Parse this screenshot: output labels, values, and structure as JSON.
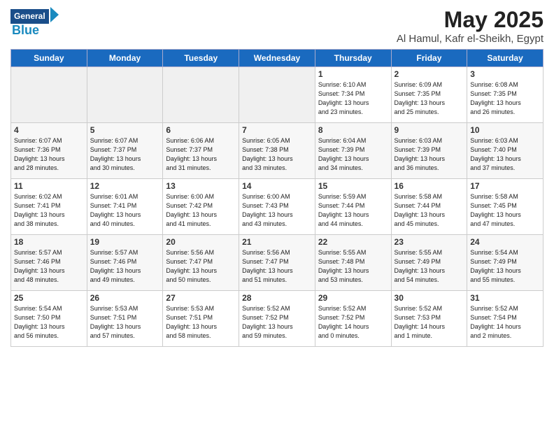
{
  "header": {
    "logo_line1": "General",
    "logo_line2": "Blue",
    "title": "May 2025",
    "subtitle": "Al Hamul, Kafr el-Sheikh, Egypt"
  },
  "days_of_week": [
    "Sunday",
    "Monday",
    "Tuesday",
    "Wednesday",
    "Thursday",
    "Friday",
    "Saturday"
  ],
  "weeks": [
    [
      {
        "day": "",
        "detail": ""
      },
      {
        "day": "",
        "detail": ""
      },
      {
        "day": "",
        "detail": ""
      },
      {
        "day": "",
        "detail": ""
      },
      {
        "day": "1",
        "detail": "Sunrise: 6:10 AM\nSunset: 7:34 PM\nDaylight: 13 hours\nand 23 minutes."
      },
      {
        "day": "2",
        "detail": "Sunrise: 6:09 AM\nSunset: 7:35 PM\nDaylight: 13 hours\nand 25 minutes."
      },
      {
        "day": "3",
        "detail": "Sunrise: 6:08 AM\nSunset: 7:35 PM\nDaylight: 13 hours\nand 26 minutes."
      }
    ],
    [
      {
        "day": "4",
        "detail": "Sunrise: 6:07 AM\nSunset: 7:36 PM\nDaylight: 13 hours\nand 28 minutes."
      },
      {
        "day": "5",
        "detail": "Sunrise: 6:07 AM\nSunset: 7:37 PM\nDaylight: 13 hours\nand 30 minutes."
      },
      {
        "day": "6",
        "detail": "Sunrise: 6:06 AM\nSunset: 7:37 PM\nDaylight: 13 hours\nand 31 minutes."
      },
      {
        "day": "7",
        "detail": "Sunrise: 6:05 AM\nSunset: 7:38 PM\nDaylight: 13 hours\nand 33 minutes."
      },
      {
        "day": "8",
        "detail": "Sunrise: 6:04 AM\nSunset: 7:39 PM\nDaylight: 13 hours\nand 34 minutes."
      },
      {
        "day": "9",
        "detail": "Sunrise: 6:03 AM\nSunset: 7:39 PM\nDaylight: 13 hours\nand 36 minutes."
      },
      {
        "day": "10",
        "detail": "Sunrise: 6:03 AM\nSunset: 7:40 PM\nDaylight: 13 hours\nand 37 minutes."
      }
    ],
    [
      {
        "day": "11",
        "detail": "Sunrise: 6:02 AM\nSunset: 7:41 PM\nDaylight: 13 hours\nand 38 minutes."
      },
      {
        "day": "12",
        "detail": "Sunrise: 6:01 AM\nSunset: 7:41 PM\nDaylight: 13 hours\nand 40 minutes."
      },
      {
        "day": "13",
        "detail": "Sunrise: 6:00 AM\nSunset: 7:42 PM\nDaylight: 13 hours\nand 41 minutes."
      },
      {
        "day": "14",
        "detail": "Sunrise: 6:00 AM\nSunset: 7:43 PM\nDaylight: 13 hours\nand 43 minutes."
      },
      {
        "day": "15",
        "detail": "Sunrise: 5:59 AM\nSunset: 7:44 PM\nDaylight: 13 hours\nand 44 minutes."
      },
      {
        "day": "16",
        "detail": "Sunrise: 5:58 AM\nSunset: 7:44 PM\nDaylight: 13 hours\nand 45 minutes."
      },
      {
        "day": "17",
        "detail": "Sunrise: 5:58 AM\nSunset: 7:45 PM\nDaylight: 13 hours\nand 47 minutes."
      }
    ],
    [
      {
        "day": "18",
        "detail": "Sunrise: 5:57 AM\nSunset: 7:46 PM\nDaylight: 13 hours\nand 48 minutes."
      },
      {
        "day": "19",
        "detail": "Sunrise: 5:57 AM\nSunset: 7:46 PM\nDaylight: 13 hours\nand 49 minutes."
      },
      {
        "day": "20",
        "detail": "Sunrise: 5:56 AM\nSunset: 7:47 PM\nDaylight: 13 hours\nand 50 minutes."
      },
      {
        "day": "21",
        "detail": "Sunrise: 5:56 AM\nSunset: 7:47 PM\nDaylight: 13 hours\nand 51 minutes."
      },
      {
        "day": "22",
        "detail": "Sunrise: 5:55 AM\nSunset: 7:48 PM\nDaylight: 13 hours\nand 53 minutes."
      },
      {
        "day": "23",
        "detail": "Sunrise: 5:55 AM\nSunset: 7:49 PM\nDaylight: 13 hours\nand 54 minutes."
      },
      {
        "day": "24",
        "detail": "Sunrise: 5:54 AM\nSunset: 7:49 PM\nDaylight: 13 hours\nand 55 minutes."
      }
    ],
    [
      {
        "day": "25",
        "detail": "Sunrise: 5:54 AM\nSunset: 7:50 PM\nDaylight: 13 hours\nand 56 minutes."
      },
      {
        "day": "26",
        "detail": "Sunrise: 5:53 AM\nSunset: 7:51 PM\nDaylight: 13 hours\nand 57 minutes."
      },
      {
        "day": "27",
        "detail": "Sunrise: 5:53 AM\nSunset: 7:51 PM\nDaylight: 13 hours\nand 58 minutes."
      },
      {
        "day": "28",
        "detail": "Sunrise: 5:52 AM\nSunset: 7:52 PM\nDaylight: 13 hours\nand 59 minutes."
      },
      {
        "day": "29",
        "detail": "Sunrise: 5:52 AM\nSunset: 7:52 PM\nDaylight: 14 hours\nand 0 minutes."
      },
      {
        "day": "30",
        "detail": "Sunrise: 5:52 AM\nSunset: 7:53 PM\nDaylight: 14 hours\nand 1 minute."
      },
      {
        "day": "31",
        "detail": "Sunrise: 5:52 AM\nSunset: 7:54 PM\nDaylight: 14 hours\nand 2 minutes."
      }
    ]
  ]
}
